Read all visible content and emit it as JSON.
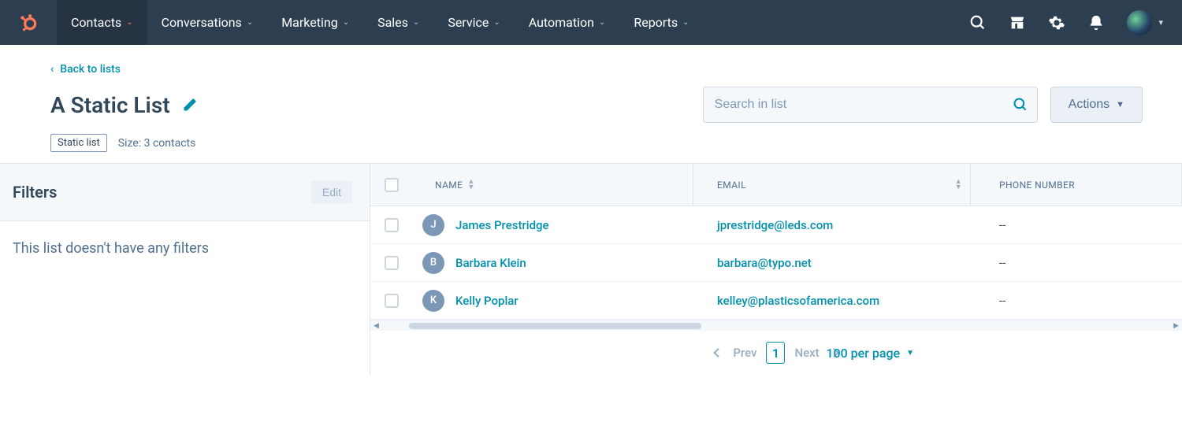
{
  "nav": {
    "items": [
      {
        "label": "Contacts",
        "active": true
      },
      {
        "label": "Conversations",
        "active": false
      },
      {
        "label": "Marketing",
        "active": false
      },
      {
        "label": "Sales",
        "active": false
      },
      {
        "label": "Service",
        "active": false
      },
      {
        "label": "Automation",
        "active": false
      },
      {
        "label": "Reports",
        "active": false
      }
    ]
  },
  "header": {
    "back_label": "Back to lists",
    "title": "A Static List",
    "search_placeholder": "Search in list",
    "actions_label": "Actions",
    "badge": "Static list",
    "size_label": "Size: 3 contacts"
  },
  "filters": {
    "title": "Filters",
    "edit_label": "Edit",
    "empty_text": "This list doesn't have any filters"
  },
  "table": {
    "columns": {
      "name": "NAME",
      "email": "EMAIL",
      "phone": "PHONE NUMBER"
    },
    "rows": [
      {
        "initial": "J",
        "color": "#7c98b6",
        "name": "James Prestridge",
        "email": "jprestridge@leds.com",
        "phone": "--"
      },
      {
        "initial": "B",
        "color": "#7c98b6",
        "name": "Barbara Klein",
        "email": "barbara@typo.net",
        "phone": "--"
      },
      {
        "initial": "K",
        "color": "#7c98b6",
        "name": "Kelly Poplar",
        "email": "kelley@plasticsofamerica.com",
        "phone": "--"
      }
    ]
  },
  "pager": {
    "prev": "Prev",
    "next": "Next",
    "page": "1",
    "per_page": "100 per page"
  },
  "colors": {
    "accent": "#0091ae",
    "brand": "#ff7a59",
    "navbg": "#2d3e50"
  }
}
